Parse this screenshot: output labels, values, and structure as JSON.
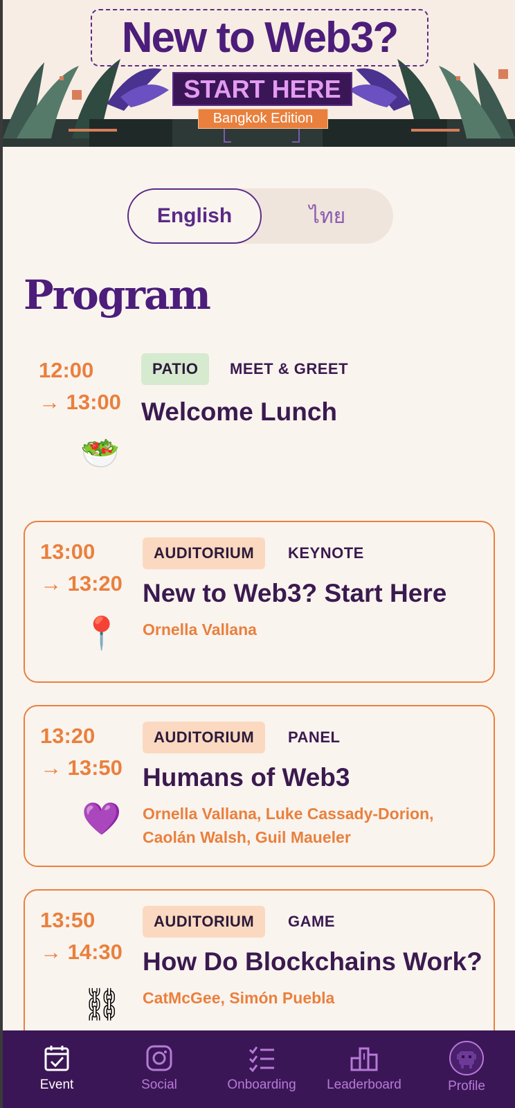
{
  "banner": {
    "title": "New to Web3?",
    "cta": "START HERE",
    "edition": "Bangkok Edition"
  },
  "language": {
    "options": [
      "English",
      "ไทย"
    ],
    "selected": "English"
  },
  "program": {
    "title": "Program",
    "sessions": [
      {
        "start": "12:00",
        "end": "→ 13:00",
        "venue": "PATIO",
        "category": "MEET & GREET",
        "title": "Welcome Lunch",
        "speakers": "",
        "emoji": "🥗",
        "icon": "salad-icon",
        "highlighted": false
      },
      {
        "start": "13:00",
        "end": "→ 13:20",
        "venue": "AUDITORIUM",
        "category": "KEYNOTE",
        "title": "New to Web3? Start Here",
        "speakers": "Ornella Vallana",
        "emoji": "📍",
        "icon": "pushpin-icon",
        "highlighted": true
      },
      {
        "start": "13:20",
        "end": "→ 13:50",
        "venue": "AUDITORIUM",
        "category": "PANEL",
        "title": "Humans of Web3",
        "speakers": "Ornella Vallana, Luke Cassady-Dorion, Caolán Walsh, Guil Maueler",
        "emoji": "💜",
        "icon": "purple-heart-icon",
        "highlighted": true
      },
      {
        "start": "13:50",
        "end": "→ 14:30",
        "venue": "AUDITORIUM",
        "category": "GAME",
        "title": "How Do Blockchains Work?",
        "speakers": "CatMcGee, Simón Puebla",
        "emoji": "⛓",
        "icon": "chains-icon",
        "highlighted": true
      }
    ]
  },
  "nav": {
    "items": [
      {
        "label": "Event",
        "icon": "calendar-check-icon",
        "active": true
      },
      {
        "label": "Social",
        "icon": "instagram-icon",
        "active": false
      },
      {
        "label": "Onboarding",
        "icon": "checklist-icon",
        "active": false
      },
      {
        "label": "Leaderboard",
        "icon": "podium-icon",
        "active": false
      },
      {
        "label": "Profile",
        "icon": "avatar-icon",
        "active": false
      }
    ]
  },
  "colors": {
    "brand_purple": "#4c1d7a",
    "accent_orange": "#e9803d",
    "background": "#faf4ef",
    "nav_background": "#3b1656"
  }
}
